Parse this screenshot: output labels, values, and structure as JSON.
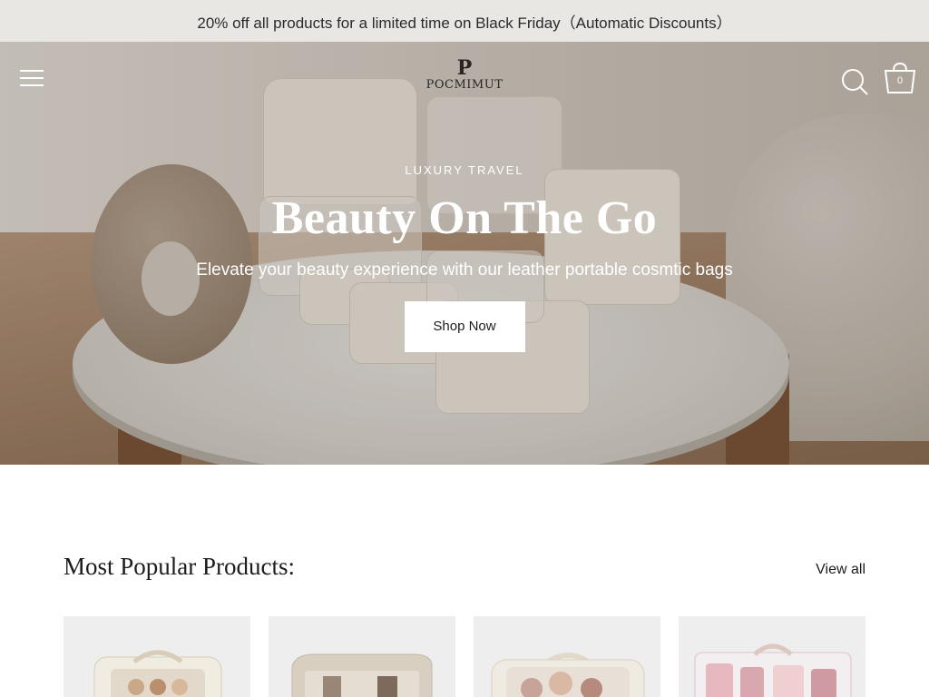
{
  "announcement": {
    "text": "20% off all products for a limited time on Black Friday（Automatic Discounts）"
  },
  "header": {
    "menu_icon": "hamburger-menu-icon",
    "logo": {
      "mark": "P",
      "text": "POCMIMUT"
    },
    "search_icon": "search-icon",
    "cart_icon": "cart-icon",
    "cart_count": "0"
  },
  "hero": {
    "eyebrow": "LUXURY TRAVEL",
    "title": "Beauty On The Go",
    "subtitle": "Elevate your beauty experience with our leather portable cosmtic bags",
    "cta_label": "Shop Now"
  },
  "popular": {
    "title": "Most Popular Products:",
    "view_all_label": "View all",
    "products": [
      {
        "image": "cream-cosmetic-case-with-clear-window"
      },
      {
        "image": "beige-clear-toiletry-bag"
      },
      {
        "image": "clear-makeup-case-with-compacts"
      },
      {
        "image": "clear-pink-cosmetic-bag"
      }
    ]
  },
  "colors": {
    "announcement_bg": "#e9e7e3",
    "text": "#1c1c1c",
    "card_bg": "#eeeeee",
    "button_bg": "#ffffff"
  }
}
